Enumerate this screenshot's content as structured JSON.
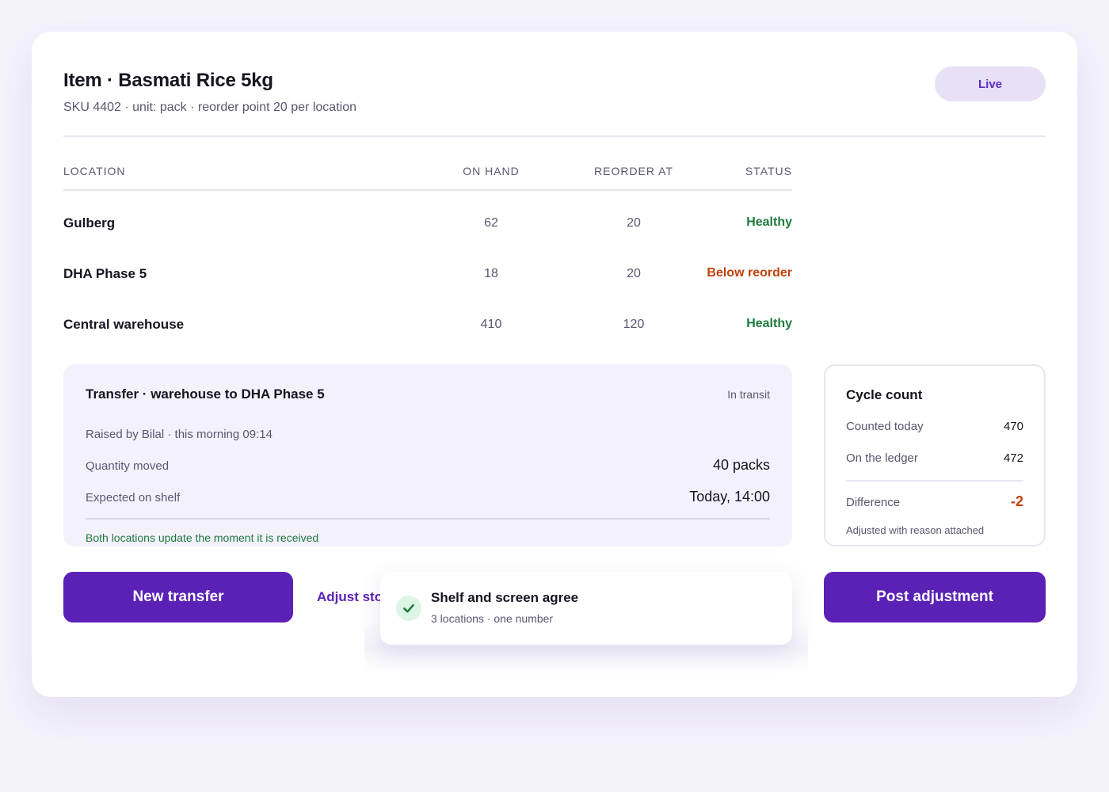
{
  "header": {
    "title": "Item · Basmati Rice 5kg",
    "subtitle": "SKU 4402 · unit: pack · reorder point 20 per location",
    "badge": "Live"
  },
  "table": {
    "columns": [
      "LOCATION",
      "ON HAND",
      "REORDER AT",
      "STATUS"
    ],
    "rows": [
      {
        "location": "Gulberg",
        "on_hand": "62",
        "reorder_at": "20",
        "status": "Healthy",
        "status_color": "#1f7a3e"
      },
      {
        "location": "DHA Phase 5",
        "on_hand": "18",
        "reorder_at": "20",
        "status": "Below reorder",
        "status_color": "#c2410c"
      },
      {
        "location": "Central warehouse",
        "on_hand": "410",
        "reorder_at": "120",
        "status": "Healthy",
        "status_color": "#1f7a3e"
      }
    ]
  },
  "transfer": {
    "title": "Transfer · warehouse to DHA Phase 5",
    "status": "In transit",
    "raised": "Raised by Bilal · this morning 09:14",
    "quantity_label": "Quantity moved",
    "quantity_value": "40 packs",
    "expected_label": "Expected on shelf",
    "expected_value": "Today, 14:00",
    "note": "Both locations update the moment it is received"
  },
  "cycle": {
    "title": "Cycle count",
    "counted_label": "Counted today",
    "counted_value": "470",
    "ledger_label": "On the ledger",
    "ledger_value": "472",
    "difference_label": "Difference",
    "difference_value": "-2",
    "note": "Adjusted with reason attached"
  },
  "actions": {
    "new_transfer": "New transfer",
    "adjust_stock": "Adjust stock",
    "post_adjustment": "Post adjustment"
  },
  "toast": {
    "title": "Shelf and screen agree",
    "subtitle": "3 locations · one number",
    "icon": "check-icon"
  },
  "colors": {
    "accent": "#5b21b6",
    "healthy": "#1f7a3e",
    "warning": "#c2410c",
    "badge_bg": "#e7e0f6"
  }
}
